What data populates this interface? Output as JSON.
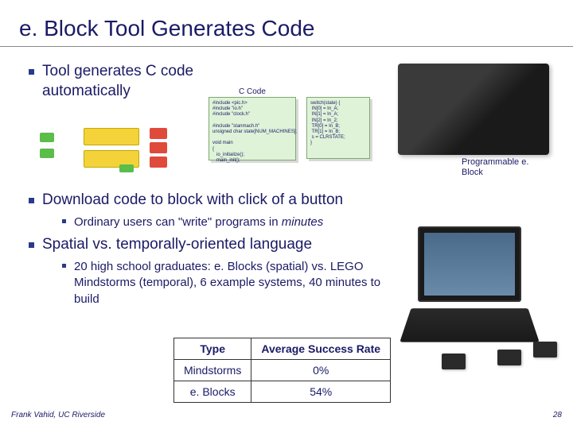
{
  "title": "e. Block Tool Generates Code",
  "bullets": {
    "b1": "Tool generates C code automatically",
    "b2": "Download code to block with click of a button",
    "b2_sub": "Ordinary users can \"write\" programs in ",
    "b2_sub_em": "minutes",
    "b3": "Spatial vs. temporally-oriented language",
    "b3_sub": "20 high school graduates: e. Blocks (spatial) vs. LEGO Mindstorms (temporal), 6 example systems, 40 minutes to build"
  },
  "ccode_label": "C Code",
  "device_label": "Programmable e. Block",
  "chart_data": {
    "type": "table",
    "title": "",
    "columns": [
      "Type",
      "Average Success Rate"
    ],
    "rows": [
      {
        "type": "Mindstorms",
        "rate": "0%"
      },
      {
        "type": "e. Blocks",
        "rate": "54%"
      }
    ]
  },
  "footer": {
    "left": "Frank Vahid, UC Riverside",
    "right": "28"
  }
}
